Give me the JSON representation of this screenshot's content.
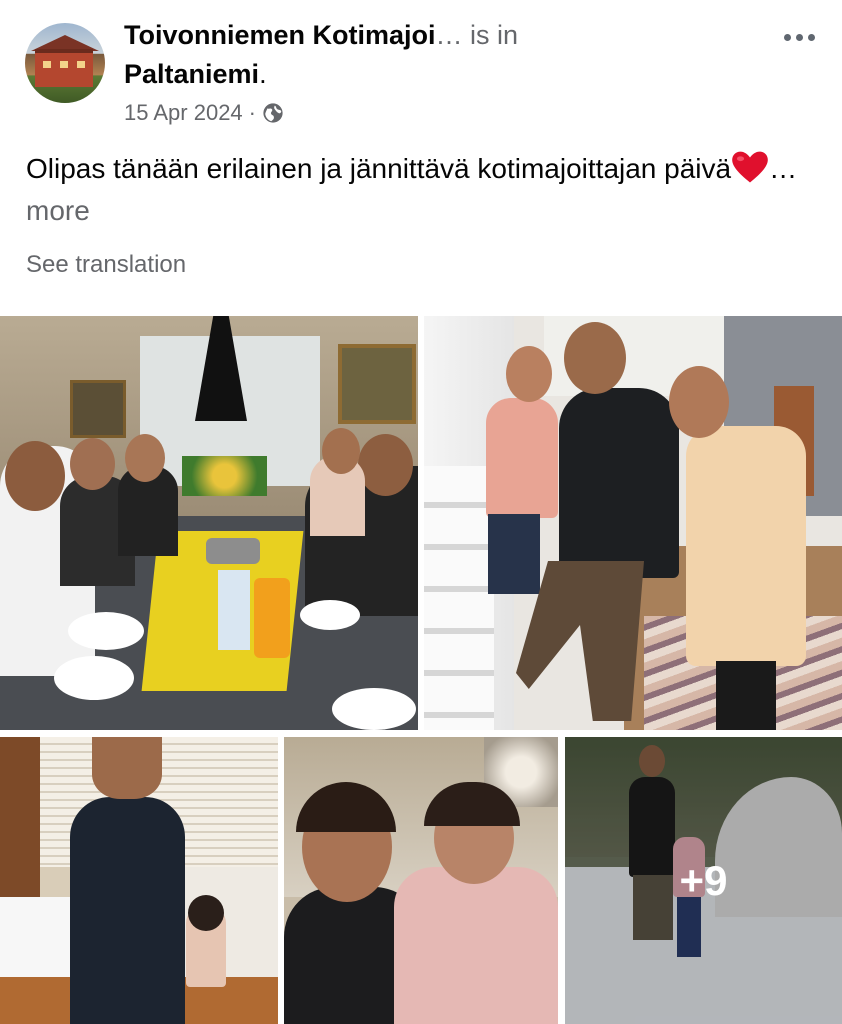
{
  "post": {
    "author_name": "Toivonniemen Kotimajoi",
    "ellipsis": "…",
    "is_in": " is in",
    "place": "Paltaniemi",
    "place_period": ".",
    "date": "15 Apr 2024",
    "separator": "·",
    "text": "Olipas tänään erilainen ja jännittävä kotimajoittajan päivä",
    "more_ellipsis": "…",
    "more_label": " more",
    "see_translation": "See translation"
  },
  "icons": {
    "audience": "globe-icon",
    "menu": "more-options-icon",
    "emoji": "red-heart-icon"
  },
  "photos": {
    "extra_count": "+9"
  },
  "colors": {
    "text_primary": "#050505",
    "text_secondary": "#65676b",
    "heart": "#e0102d"
  }
}
